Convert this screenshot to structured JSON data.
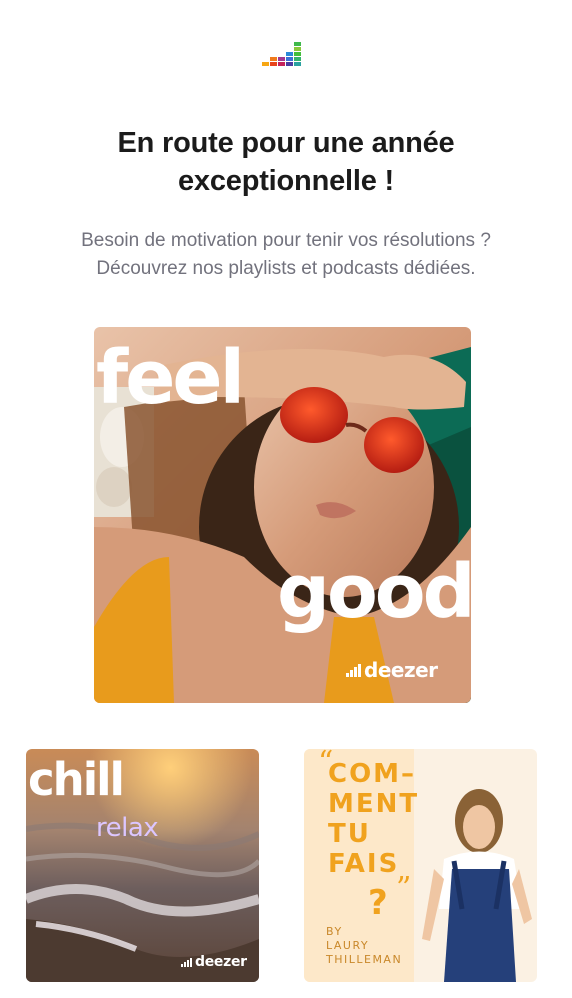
{
  "header": {
    "logo": "deezer-logo-icon",
    "title": "En route pour une année exceptionnelle !",
    "subtitle_line1": "Besoin de motivation pour tenir vos résolutions ?",
    "subtitle_line2": "Découvrez nos playlists et podcasts dédiées."
  },
  "cards": {
    "feel_good": {
      "word1": "feel",
      "word2": "good",
      "brand": "deezer"
    },
    "chill_relax": {
      "word1": "chill",
      "word2": "relax",
      "brand": "deezer"
    },
    "podcast": {
      "title_line1": "COM–",
      "title_line2": "MENT",
      "title_line3": "TU",
      "title_line4": "FAIS",
      "question_mark": "?",
      "open_quote": "“",
      "close_quote": "”",
      "by_line1": "BY",
      "by_line2": "LAURY",
      "by_line3": "THILLEMAN"
    }
  },
  "colors": {
    "headline": "#1b1b1b",
    "subtitle": "#72727d",
    "podcast_accent": "#f0a21e",
    "relax_text": "#dcc6ff"
  }
}
